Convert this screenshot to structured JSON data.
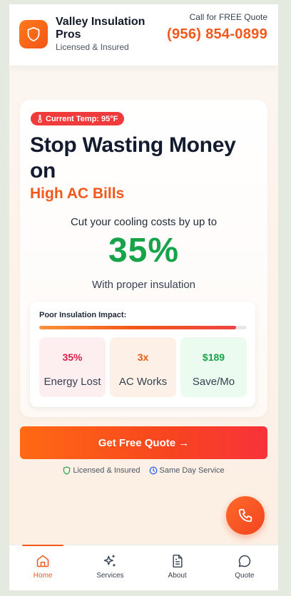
{
  "header": {
    "brand_name": "Valley Insulation Pros",
    "brand_tagline": "Licensed & Insured",
    "cta_label": "Call for FREE Quote",
    "cta_phone": "(956) 854-0899",
    "logo_icon": "shield-icon"
  },
  "hero": {
    "temp_badge": "Current Temp: 95°F",
    "temp_icon": "thermometer-icon",
    "headline": "Stop Wasting Money on",
    "headline_accent": "High AC Bills",
    "subtitle": "Cut your cooling costs by up to",
    "big_value": "35%",
    "subtitle2": "With proper insulation",
    "impact": {
      "title": "Poor Insulation Impact:",
      "progress_percent": 95,
      "stats": [
        {
          "value": "35%",
          "label": "Energy Lost"
        },
        {
          "value": "3x",
          "label": "AC Works"
        },
        {
          "value": "$189",
          "label": "Save/Mo"
        }
      ]
    }
  },
  "cta": {
    "button_label": "Get Free Quote →"
  },
  "trust": {
    "item1": "Licensed & Insured",
    "item2": "Same Day Service"
  },
  "nav": {
    "items": [
      {
        "label": "Home",
        "icon": "home-icon",
        "active": true
      },
      {
        "label": "Services",
        "icon": "sparkles-icon",
        "active": false
      },
      {
        "label": "About",
        "icon": "document-icon",
        "active": false
      },
      {
        "label": "Quote",
        "icon": "chat-bubble-icon",
        "active": false
      }
    ]
  },
  "colors": {
    "accent": "#f2571b",
    "success": "#16a34a",
    "danger": "#ef3b3b"
  }
}
